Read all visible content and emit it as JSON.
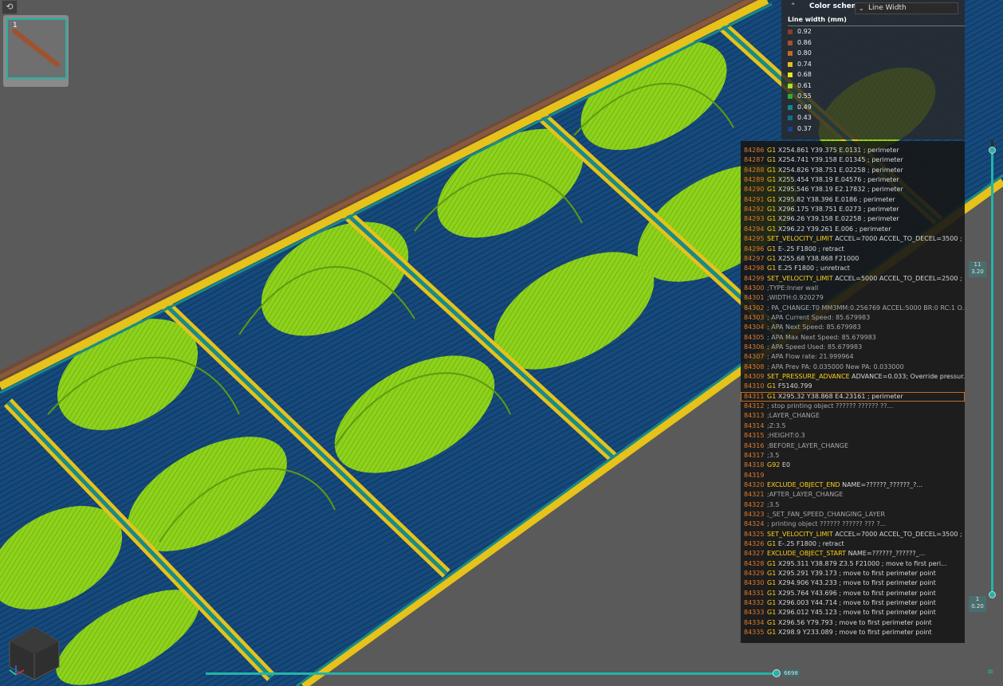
{
  "objects_panel": {
    "thumbnail_index": "1"
  },
  "legend": {
    "color_scheme_label": "Color scheme",
    "scheme_value": "Line Width",
    "title": "Line width (mm)",
    "items": [
      {
        "value": "0.92",
        "color": "#8b3a2c"
      },
      {
        "value": "0.86",
        "color": "#a5502e"
      },
      {
        "value": "0.80",
        "color": "#c26a26"
      },
      {
        "value": "0.74",
        "color": "#e9ba1c"
      },
      {
        "value": "0.68",
        "color": "#e8e61f"
      },
      {
        "value": "0.61",
        "color": "#a8df24"
      },
      {
        "value": "0.55",
        "color": "#2cae32"
      },
      {
        "value": "0.49",
        "color": "#12898a"
      },
      {
        "value": "0.43",
        "color": "#146c8c"
      },
      {
        "value": "0.37",
        "color": "#17428a"
      }
    ]
  },
  "gcode": [
    {
      "n": "84286",
      "k": "G1",
      "r": " X254.861 Y39.375 E.0131 ; perimeter"
    },
    {
      "n": "84287",
      "k": "G1",
      "r": " X254.741 Y39.158 E.01345 ; perimeter"
    },
    {
      "n": "84288",
      "k": "G1",
      "r": " X254.826 Y38.751 E.02258 ; perimeter"
    },
    {
      "n": "84289",
      "k": "G1",
      "r": " X255.454 Y38.19 E.04576 ; perimeter"
    },
    {
      "n": "84290",
      "k": "G1",
      "r": " X295.546 Y38.19 E2.17832 ; perimeter"
    },
    {
      "n": "84291",
      "k": "G1",
      "r": " X295.82 Y38.396 E.0186 ; perimeter"
    },
    {
      "n": "84292",
      "k": "G1",
      "r": " X296.175 Y38.751 E.0273 ; perimeter"
    },
    {
      "n": "84293",
      "k": "G1",
      "r": " X296.26 Y39.158 E.02258 ; perimeter"
    },
    {
      "n": "84294",
      "k": "G1",
      "r": " X296.22 Y39.261 E.006 ; perimeter"
    },
    {
      "n": "84295",
      "k": "SET_VELOCITY_LIMIT",
      "r": " ACCEL=7000 ACCEL_TO_DECEL=3500 ; ..."
    },
    {
      "n": "84296",
      "k": "G1",
      "r": " E-.25 F1800 ; retract"
    },
    {
      "n": "84297",
      "k": "G1",
      "r": " X255.68 Y38.868 F21000"
    },
    {
      "n": "84298",
      "k": "G1",
      "r": " E.25 F1800 ; unretract"
    },
    {
      "n": "84299",
      "k": "SET_VELOCITY_LIMIT",
      "r": " ACCEL=5000 ACCEL_TO_DECEL=2500 ; ..."
    },
    {
      "n": "84300",
      "k": "",
      "r": ";TYPE:Inner wall",
      "c": true
    },
    {
      "n": "84301",
      "k": "",
      "r": ";WIDTH:0.920279",
      "c": true
    },
    {
      "n": "84302",
      "k": "",
      "r": "; PA_CHANGE:T0 MM3MM:0.256769 ACCEL:5000 BR:0 RC:1 O...",
      "c": true
    },
    {
      "n": "84303",
      "k": "",
      "r": "; APA Current Speed: 85.679983",
      "c": true
    },
    {
      "n": "84304",
      "k": "",
      "r": "; APA Next Speed: 85.679983",
      "c": true
    },
    {
      "n": "84305",
      "k": "",
      "r": "; APA Max Next Speed: 85.679983",
      "c": true
    },
    {
      "n": "84306",
      "k": "",
      "r": "; APA Speed Used: 85.679983",
      "c": true
    },
    {
      "n": "84307",
      "k": "",
      "r": "; APA Flow rate: 21.999964",
      "c": true
    },
    {
      "n": "84308",
      "k": "",
      "r": "; APA Prev PA: 0.035000 New PA: 0.033000",
      "c": true
    },
    {
      "n": "84309",
      "k": "SET_PRESSURE_ADVANCE",
      "r": " ADVANCE=0.033; Override pressur..."
    },
    {
      "n": "84310",
      "k": "G1",
      "r": " F5140.799"
    },
    {
      "n": "84311",
      "k": "G1",
      "r": " X295.32 Y38.868 E4.23161 ; perimeter",
      "hl": true
    },
    {
      "n": "84312",
      "k": "",
      "r": "; stop printing object ?????? ?????? ??...",
      "c": true
    },
    {
      "n": "84313",
      "k": "",
      "r": ";LAYER_CHANGE",
      "c": true
    },
    {
      "n": "84314",
      "k": "",
      "r": ";Z:3.5",
      "c": true
    },
    {
      "n": "84315",
      "k": "",
      "r": ";HEIGHT:0.3",
      "c": true
    },
    {
      "n": "84316",
      "k": "",
      "r": ";BEFORE_LAYER_CHANGE",
      "c": true
    },
    {
      "n": "84317",
      "k": "",
      "r": ";3.5",
      "c": true
    },
    {
      "n": "84318",
      "k": "G92",
      "r": " E0"
    },
    {
      "n": "84319",
      "k": "",
      "r": ""
    },
    {
      "n": "84320",
      "k": "EXCLUDE_OBJECT_END",
      "r": " NAME=??????_??????_?..."
    },
    {
      "n": "84321",
      "k": "",
      "r": ";AFTER_LAYER_CHANGE",
      "c": true
    },
    {
      "n": "84322",
      "k": "",
      "r": ";3.5",
      "c": true
    },
    {
      "n": "84323",
      "k": "",
      "r": ";_SET_FAN_SPEED_CHANGING_LAYER",
      "c": true
    },
    {
      "n": "84324",
      "k": "",
      "r": "; printing object ?????? ?????? ??? ?...",
      "c": true
    },
    {
      "n": "84325",
      "k": "SET_VELOCITY_LIMIT",
      "r": " ACCEL=7000 ACCEL_TO_DECEL=3500 ; ..."
    },
    {
      "n": "84326",
      "k": "G1",
      "r": " E-.25 F1800 ; retract"
    },
    {
      "n": "84327",
      "k": "EXCLUDE_OBJECT_START",
      "r": " NAME=??????_??????_..."
    },
    {
      "n": "84328",
      "k": "G1",
      "r": " X295.311 Y38.879 Z3.5 F21000 ; move to first peri..."
    },
    {
      "n": "84329",
      "k": "G1",
      "r": " X295.291 Y39.173 ; move to first perimeter point"
    },
    {
      "n": "84330",
      "k": "G1",
      "r": " X294.906 Y43.233 ; move to first perimeter point"
    },
    {
      "n": "84331",
      "k": "G1",
      "r": " X295.764 Y43.696 ; move to first perimeter point"
    },
    {
      "n": "84332",
      "k": "G1",
      "r": " X296.003 Y44.714 ; move to first perimeter point"
    },
    {
      "n": "84333",
      "k": "G1",
      "r": " X296.012 Y45.123 ; move to first perimeter point"
    },
    {
      "n": "84334",
      "k": "G1",
      "r": " X296.56 Y79.793 ; move to first perimeter point"
    },
    {
      "n": "84335",
      "k": "G1",
      "r": " X298.9 Y233.089 ; move to first perimeter point"
    }
  ],
  "layer_slider": {
    "top_layer": "11",
    "top_height": "3.20",
    "bottom_layer": "1",
    "bottom_height": "0.20"
  },
  "move_slider": {
    "value": "6698"
  },
  "icons": {
    "collapse": "collapse-arrows-icon",
    "menu": "menu-icon",
    "view_cube": "view-cube-icon"
  }
}
